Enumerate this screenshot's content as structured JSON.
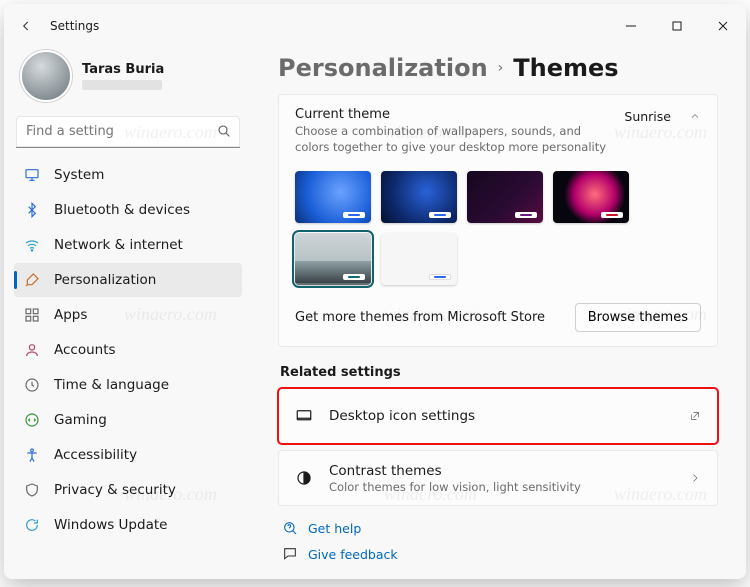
{
  "window": {
    "title": "Settings"
  },
  "profile": {
    "name": "Taras Buria"
  },
  "search": {
    "placeholder": "Find a setting"
  },
  "nav": {
    "items": [
      {
        "label": "System"
      },
      {
        "label": "Bluetooth & devices"
      },
      {
        "label": "Network & internet"
      },
      {
        "label": "Personalization"
      },
      {
        "label": "Apps"
      },
      {
        "label": "Accounts"
      },
      {
        "label": "Time & language"
      },
      {
        "label": "Gaming"
      },
      {
        "label": "Accessibility"
      },
      {
        "label": "Privacy & security"
      },
      {
        "label": "Windows Update"
      }
    ]
  },
  "crumbs": {
    "parent": "Personalization",
    "current": "Themes"
  },
  "currentTheme": {
    "title": "Current theme",
    "desc": "Choose a combination of wallpapers, sounds, and colors together to give your desktop more personality",
    "selectedName": "Sunrise",
    "storeText": "Get more themes from Microsoft Store",
    "browseBtn": "Browse themes"
  },
  "related": {
    "title": "Related settings",
    "desktopIcons": {
      "label": "Desktop icon settings"
    },
    "contrast": {
      "label": "Contrast themes",
      "desc": "Color themes for low vision, light sensitivity"
    }
  },
  "bottom": {
    "help": "Get help",
    "feedback": "Give feedback"
  },
  "watermark": "winaero.com"
}
